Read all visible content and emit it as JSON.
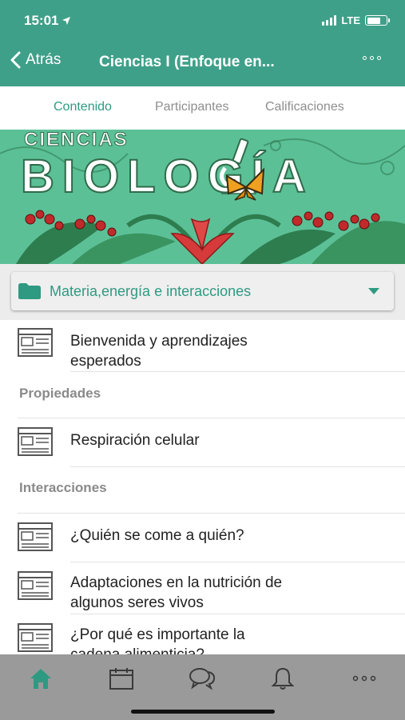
{
  "status_bar": {
    "time": "15:01",
    "network": "LTE"
  },
  "header": {
    "back_label": "Atrás",
    "title": "Ciencias I (Enfoque en..."
  },
  "tabs": [
    {
      "label": "Contenido",
      "active": true
    },
    {
      "label": "Participantes",
      "active": false
    },
    {
      "label": "Calificaciones",
      "active": false
    }
  ],
  "banner": {
    "top_text": "CIENCIAS",
    "main_text": "BIOLOGÍA"
  },
  "selector": {
    "value": "Materia,energía e interacciones"
  },
  "list": {
    "item_welcome": {
      "line1": "Bienvenida y aprendizajes",
      "line2": "esperados"
    },
    "section_propiedades": "Propiedades",
    "item_respiracion": "Respiración celular",
    "section_interacciones": "Interacciones",
    "item_quien": "¿Quién se come a quién?",
    "item_adaptaciones": {
      "line1": "Adaptaciones en la nutrición de",
      "line2": "algunos seres vivos"
    },
    "item_porque": {
      "line1": "¿Por qué es importante la",
      "line2": "cadena alimenticia?"
    }
  },
  "colors": {
    "header": "#3fa089",
    "accent": "#2e9a82",
    "banner_bg": "#5cc097",
    "tabbar": "#9a9a9a"
  },
  "bottom_bar": [
    "home-icon",
    "calendar-icon",
    "chat-icon",
    "bell-icon",
    "more-icon"
  ]
}
